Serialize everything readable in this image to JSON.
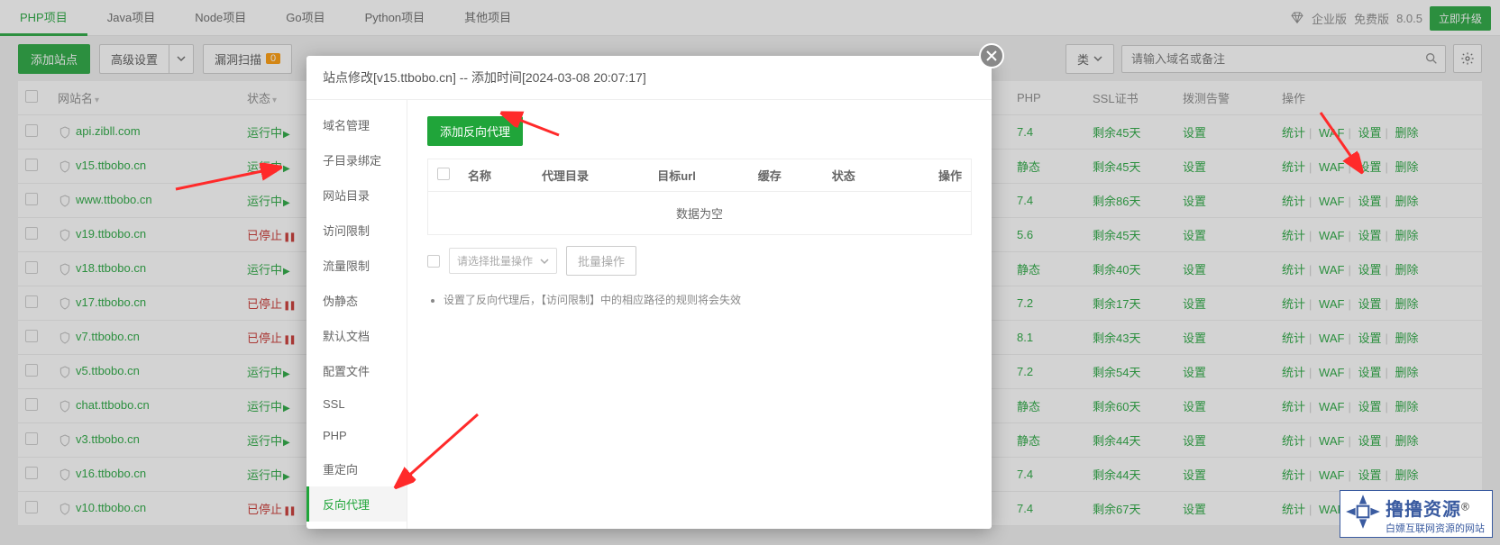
{
  "top_tabs": [
    "PHP项目",
    "Java项目",
    "Node项目",
    "Go项目",
    "Python项目",
    "其他项目"
  ],
  "top_active_index": 0,
  "top_right": {
    "enterprise": "企业版",
    "free": "免费版",
    "version": "8.0.5",
    "upgrade": "立即升级"
  },
  "toolbar": {
    "add_site": "添加站点",
    "advanced": "高级设置",
    "scan": "漏洞扫描",
    "scan_count": "0",
    "category_suffix": "类",
    "search_placeholder": "请输入域名或备注"
  },
  "columns": {
    "checkbox": "",
    "name": "网站名",
    "status": "状态",
    "php": "PHP",
    "ssl": "SSL证书",
    "alert": "拨测告警",
    "op": "操作"
  },
  "sites": [
    {
      "name": "api.zibll.com",
      "status_text": "运行中",
      "status": "run",
      "php": "7.4",
      "ssl": "剩余45天",
      "alert": "设置"
    },
    {
      "name": "v15.ttbobo.cn",
      "status_text": "运行中",
      "status": "run",
      "php": "静态",
      "ssl": "剩余45天",
      "alert": "设置"
    },
    {
      "name": "www.ttbobo.cn",
      "status_text": "运行中",
      "status": "run",
      "php": "7.4",
      "ssl": "剩余86天",
      "alert": "设置"
    },
    {
      "name": "v19.ttbobo.cn",
      "status_text": "已停止",
      "status": "stop",
      "php": "5.6",
      "ssl": "剩余45天",
      "alert": "设置"
    },
    {
      "name": "v18.ttbobo.cn",
      "status_text": "运行中",
      "status": "run",
      "php": "静态",
      "ssl": "剩余40天",
      "alert": "设置"
    },
    {
      "name": "v17.ttbobo.cn",
      "status_text": "已停止",
      "status": "stop",
      "php": "7.2",
      "ssl": "剩余17天",
      "alert": "设置"
    },
    {
      "name": "v7.ttbobo.cn",
      "status_text": "已停止",
      "status": "stop",
      "php": "8.1",
      "ssl": "剩余43天",
      "alert": "设置"
    },
    {
      "name": "v5.ttbobo.cn",
      "status_text": "运行中",
      "status": "run",
      "php": "7.2",
      "ssl": "剩余54天",
      "alert": "设置"
    },
    {
      "name": "chat.ttbobo.cn",
      "status_text": "运行中",
      "status": "run",
      "php": "静态",
      "ssl": "剩余60天",
      "alert": "设置"
    },
    {
      "name": "v3.ttbobo.cn",
      "status_text": "运行中",
      "status": "run",
      "php": "静态",
      "ssl": "剩余44天",
      "alert": "设置"
    },
    {
      "name": "v16.ttbobo.cn",
      "status_text": "运行中",
      "status": "run",
      "php": "7.4",
      "ssl": "剩余44天",
      "alert": "设置"
    },
    {
      "name": "v10.ttbobo.cn",
      "status_text": "已停止",
      "status": "stop",
      "php": "7.4",
      "ssl": "剩余67天",
      "alert": "设置"
    }
  ],
  "row_actions": {
    "stat": "统计",
    "waf": "WAF",
    "set": "设置",
    "del": "删除"
  },
  "modal": {
    "title": "站点修改[v15.ttbobo.cn] -- 添加时间[2024-03-08 20:07:17]",
    "side_items": [
      "域名管理",
      "子目录绑定",
      "网站目录",
      "访问限制",
      "流量限制",
      "伪静态",
      "默认文档",
      "配置文件",
      "SSL",
      "PHP",
      "重定向",
      "反向代理"
    ],
    "side_active_index": 11,
    "add_proxy": "添加反向代理",
    "proxy_cols": {
      "name": "名称",
      "dir": "代理目录",
      "target": "目标url",
      "cache": "缓存",
      "status": "状态",
      "op": "操作"
    },
    "empty": "数据为空",
    "bulk_placeholder": "请选择批量操作",
    "bulk_btn": "批量操作",
    "note": "设置了反向代理后，【访问限制】中的相应路径的规则将会失效"
  },
  "watermark": {
    "title": "撸撸资源",
    "reg": "®",
    "sub": "白嫖互联网资源的网站"
  }
}
